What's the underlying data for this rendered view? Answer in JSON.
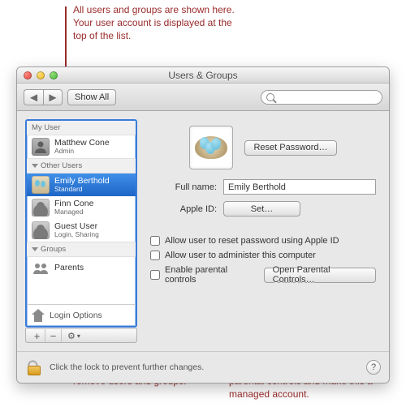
{
  "annotations": {
    "top": "All users and groups are shown here. Your user account is displayed at the top of the list.",
    "bottom_left": "Use these buttons to add and remove users and groups.",
    "bottom_right": "Select this checkbox to enable parental controls and make this a managed account."
  },
  "window": {
    "title": "Users & Groups",
    "toolbar": {
      "back_label": "◀",
      "fwd_label": "▶",
      "showall_label": "Show All",
      "search_placeholder": ""
    }
  },
  "sidebar": {
    "sections": {
      "my_user_header": "My User",
      "other_users_header": "Other Users",
      "groups_header": "Groups"
    },
    "my_user": {
      "name": "Matthew Cone",
      "role": "Admin"
    },
    "other_users": [
      {
        "name": "Emily Berthold",
        "role": "Standard",
        "selected": true
      },
      {
        "name": "Finn Cone",
        "role": "Managed"
      },
      {
        "name": "Guest User",
        "role": "Login, Sharing"
      }
    ],
    "groups": [
      {
        "name": "Parents"
      }
    ],
    "login_options_label": "Login Options",
    "footer": {
      "add": "+",
      "remove": "−"
    }
  },
  "main": {
    "reset_password_label": "Reset Password…",
    "fullname_label": "Full name:",
    "fullname_value": "Emily Berthold",
    "appleid_label": "Apple ID:",
    "appleid_set_label": "Set…",
    "checks": {
      "allow_reset": "Allow user to reset password using Apple ID",
      "allow_admin": "Allow user to administer this computer",
      "parental": "Enable parental controls",
      "open_parental_label": "Open Parental Controls…"
    }
  },
  "lock": {
    "text": "Click the lock to prevent further changes.",
    "help": "?"
  }
}
